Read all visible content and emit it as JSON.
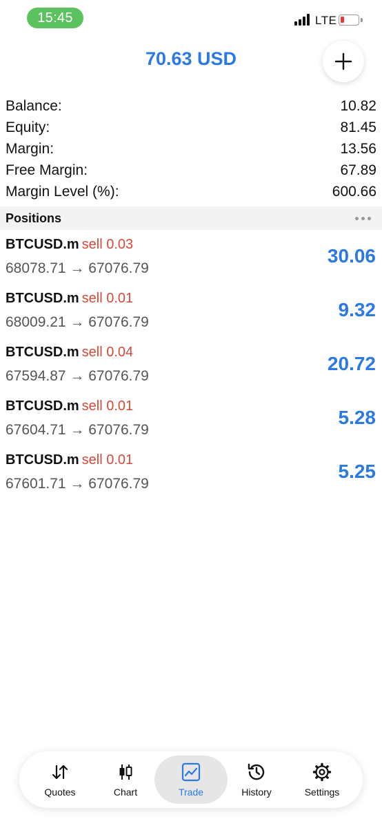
{
  "status_bar": {
    "time": "15:45",
    "network": "LTE"
  },
  "header": {
    "total": "70.63 USD",
    "add_icon": "plus-icon"
  },
  "summary": [
    {
      "label": "Balance:",
      "value": "10.82"
    },
    {
      "label": "Equity:",
      "value": "81.45"
    },
    {
      "label": "Margin:",
      "value": "13.56"
    },
    {
      "label": "Free Margin:",
      "value": "67.89"
    },
    {
      "label": "Margin Level (%):",
      "value": "600.66"
    }
  ],
  "positions": {
    "title": "Positions",
    "items": [
      {
        "symbol": "BTCUSD.m",
        "type": "sell 0.03",
        "prices": "68078.71 → 67076.79",
        "profit": "30.06"
      },
      {
        "symbol": "BTCUSD.m",
        "type": "sell 0.01",
        "prices": "68009.21 → 67076.79",
        "profit": "9.32"
      },
      {
        "symbol": "BTCUSD.m",
        "type": "sell 0.04",
        "prices": "67594.87 → 67076.79",
        "profit": "20.72"
      },
      {
        "symbol": "BTCUSD.m",
        "type": "sell 0.01",
        "prices": "67604.71 → 67076.79",
        "profit": "5.28"
      },
      {
        "symbol": "BTCUSD.m",
        "type": "sell 0.01",
        "prices": "67601.71 → 67076.79",
        "profit": "5.25"
      }
    ]
  },
  "tabs": [
    {
      "label": "Quotes",
      "icon": "quotes-arrows-icon"
    },
    {
      "label": "Chart",
      "icon": "candlestick-icon"
    },
    {
      "label": "Trade",
      "icon": "trade-chart-icon",
      "active": true
    },
    {
      "label": "History",
      "icon": "history-clock-icon"
    },
    {
      "label": "Settings",
      "icon": "gear-icon"
    }
  ],
  "colors": {
    "accent": "#2a7ae2",
    "sell": "#d34a3a",
    "time_pill": "#5cc15f"
  }
}
